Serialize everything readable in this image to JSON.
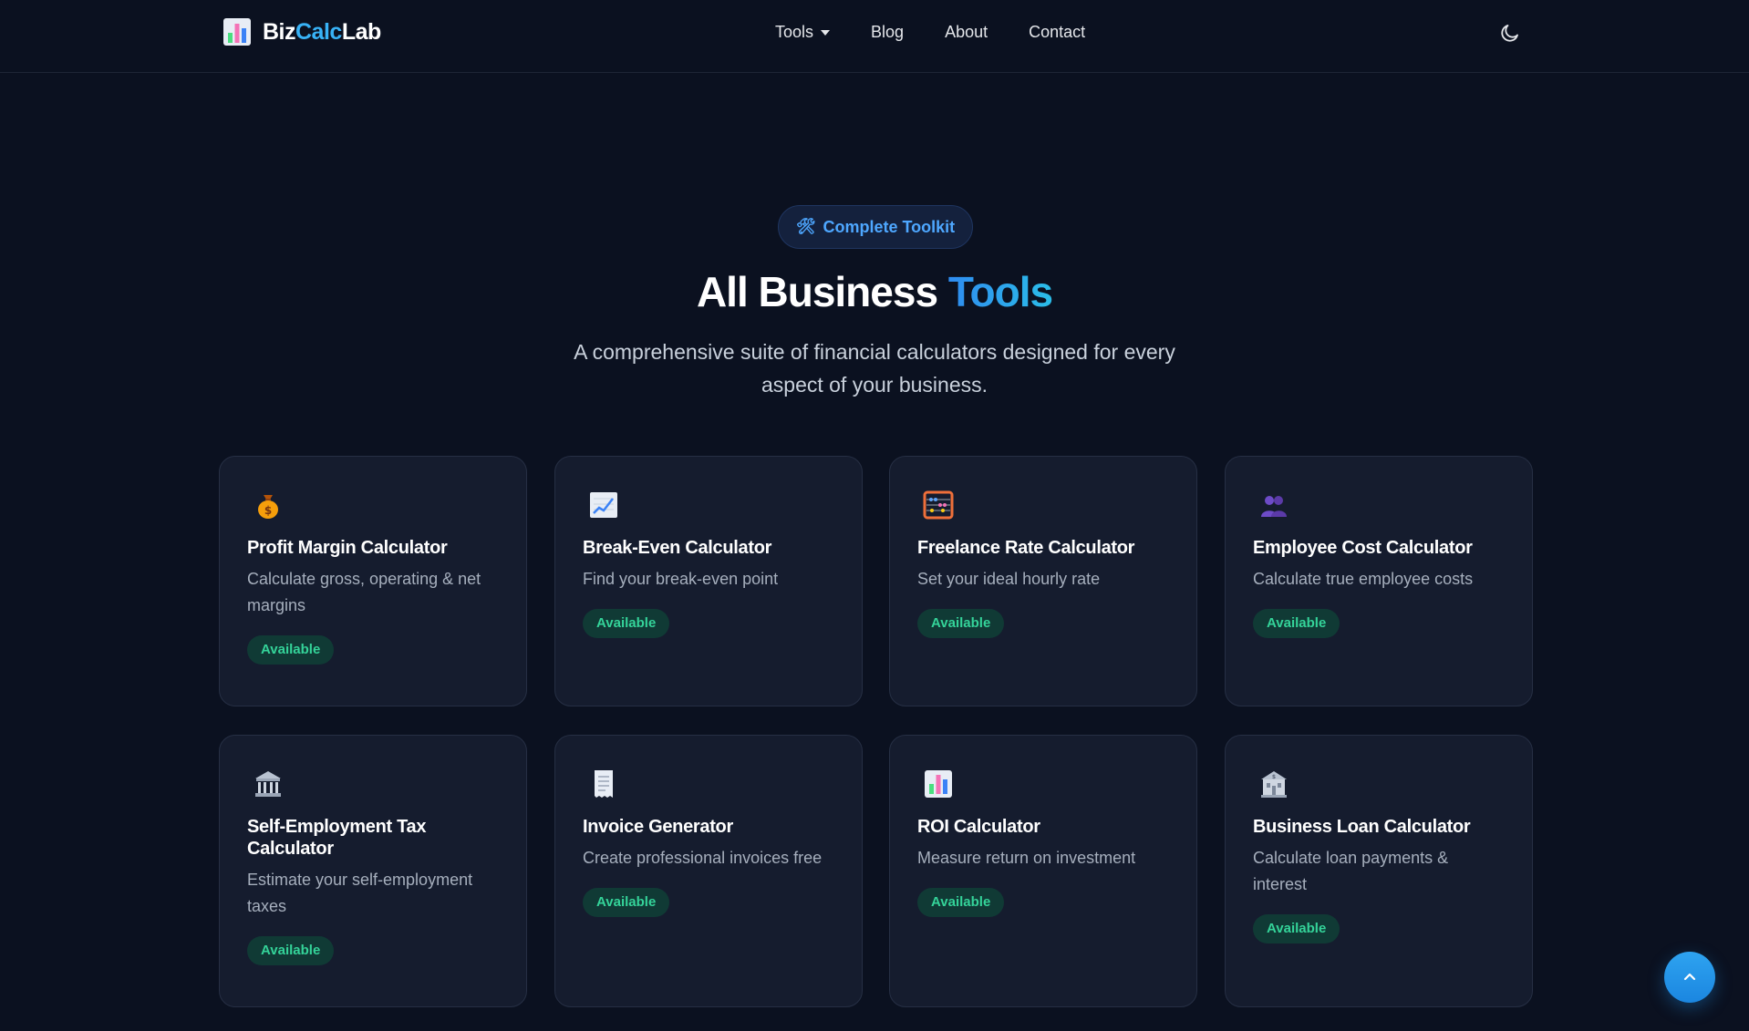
{
  "header": {
    "brand": {
      "part1": "Biz",
      "part2": "Calc",
      "part3": "Lab",
      "logo_icon": "bar-chart-icon"
    },
    "nav": [
      {
        "label": "Tools",
        "has_dropdown": true
      },
      {
        "label": "Blog"
      },
      {
        "label": "About"
      },
      {
        "label": "Contact"
      }
    ],
    "theme_toggle_icon": "moon-icon"
  },
  "hero": {
    "badge_icon": "hammer-wrench-icon",
    "badge_label": "Complete Toolkit",
    "title_main": "All Business ",
    "title_accent": "Tools",
    "subtitle": "A comprehensive suite of financial calculators designed for every aspect of your business."
  },
  "cards": [
    {
      "icon": "money-bag-icon",
      "title": "Profit Margin Calculator",
      "description": "Calculate gross, operating & net margins",
      "status": "Available"
    },
    {
      "icon": "chart-increasing-icon",
      "title": "Break-Even Calculator",
      "description": "Find your break-even point",
      "status": "Available"
    },
    {
      "icon": "abacus-icon",
      "title": "Freelance Rate Calculator",
      "description": "Set your ideal hourly rate",
      "status": "Available"
    },
    {
      "icon": "users-icon",
      "title": "Employee Cost Calculator",
      "description": "Calculate true employee costs",
      "status": "Available"
    },
    {
      "icon": "classical-building-icon",
      "title": "Self-Employment Tax Calculator",
      "description": "Estimate your self-employment taxes",
      "status": "Available"
    },
    {
      "icon": "receipt-icon",
      "title": "Invoice Generator",
      "description": "Create professional invoices free",
      "status": "Available"
    },
    {
      "icon": "bar-chart-icon",
      "title": "ROI Calculator",
      "description": "Measure return on investment",
      "status": "Available"
    },
    {
      "icon": "bank-icon",
      "title": "Business Loan Calculator",
      "description": "Calculate loan payments & interest",
      "status": "Available"
    }
  ],
  "scroll_top_icon": "chevron-up-icon",
  "colors": {
    "background": "#0b1120",
    "card_background": "#151c2e",
    "accent_blue": "#38b2f6",
    "available_green": "#34d399"
  }
}
